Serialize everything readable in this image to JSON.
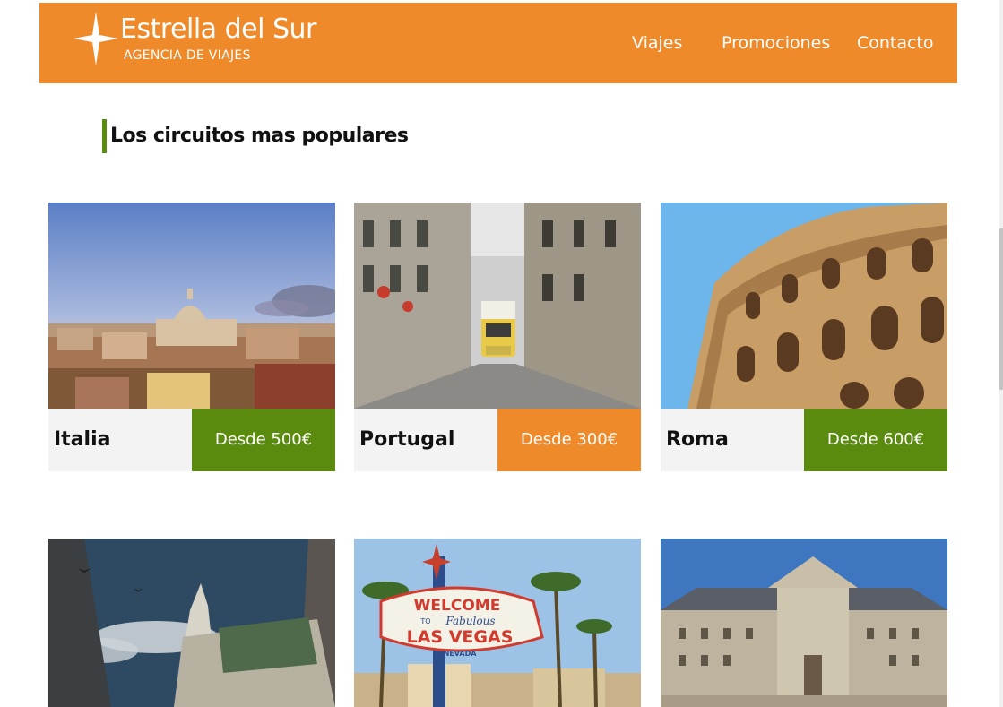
{
  "brand": {
    "name": "Estrella del Sur",
    "tagline": "AGENCIA DE VIAJES"
  },
  "nav": {
    "items": [
      "Viajes",
      "Promociones",
      "Contacto"
    ]
  },
  "section": {
    "title": "Los circuitos mas populares"
  },
  "colors": {
    "header": "#ef8a2b",
    "accent_green": "#5b8b0e",
    "accent_orange": "#ef8a2b"
  },
  "cards": [
    {
      "name": "Italia",
      "price": "Desde 500€",
      "price_color": "green",
      "image": "rome-skyline-photo"
    },
    {
      "name": "Portugal",
      "price": "Desde 300€",
      "price_color": "orange",
      "image": "lisbon-tram-photo"
    },
    {
      "name": "Roma",
      "price": "Desde 600€",
      "price_color": "green",
      "image": "colosseum-photo"
    },
    {
      "name": "",
      "price": "",
      "image": "vienna-cathedral-photo"
    },
    {
      "name": "",
      "price": "",
      "image": "las-vegas-sign-photo"
    },
    {
      "name": "",
      "price": "",
      "image": "el-escorial-photo"
    }
  ],
  "vegas_sign": {
    "welcome": "WELCOME",
    "to": "TO",
    "fabulous": "Fabulous",
    "city": "LAS VEGAS",
    "state": "NEVADA"
  }
}
